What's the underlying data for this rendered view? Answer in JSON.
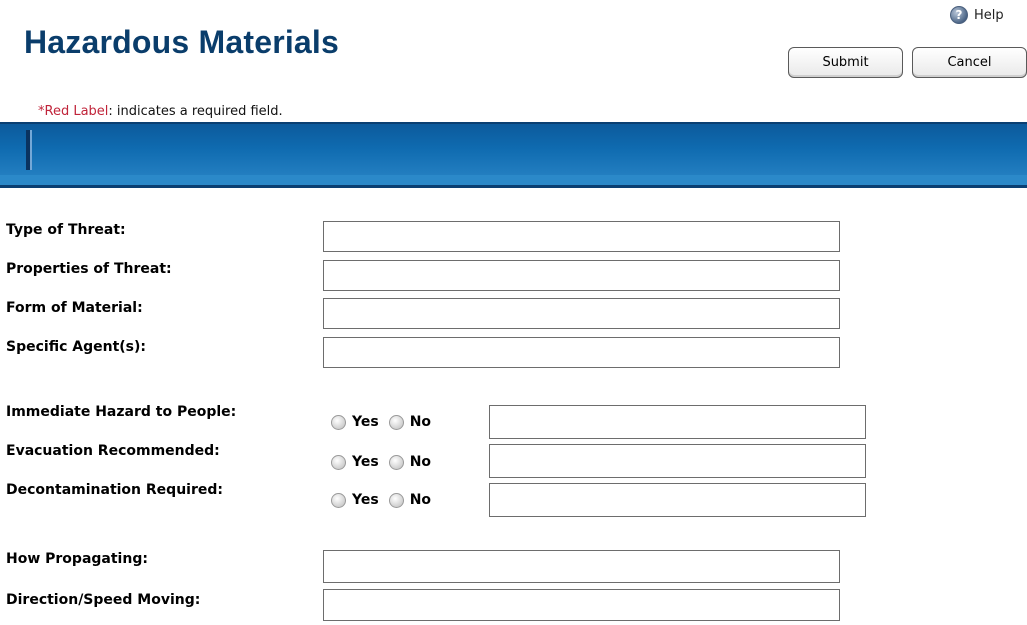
{
  "header": {
    "title": "Hazardous Materials",
    "help_label": "Help",
    "help_icon": "?"
  },
  "toolbar": {
    "submit_label": "Submit",
    "cancel_label": "Cancel"
  },
  "required_note": {
    "red_part": "*Red Label",
    "rest": ": indicates a required field."
  },
  "colors": {
    "title": "#0a3d6b",
    "required_red": "#c0243a",
    "bar_blue": "#0f6bb0"
  },
  "fields": {
    "type_of_threat": {
      "label": "Type of Threat:",
      "value": ""
    },
    "properties_of_threat": {
      "label": "Properties of Threat:",
      "value": ""
    },
    "form_of_material": {
      "label": "Form of Material:",
      "value": ""
    },
    "specific_agents": {
      "label": "Specific Agent(s):",
      "value": ""
    },
    "immediate_hazard": {
      "label": "Immediate Hazard to People:",
      "yes": "Yes",
      "no": "No",
      "value": ""
    },
    "evacuation": {
      "label": "Evacuation Recommended:",
      "yes": "Yes",
      "no": "No",
      "value": ""
    },
    "decontamination": {
      "label": "Decontamination Required:",
      "yes": "Yes",
      "no": "No",
      "value": ""
    },
    "how_propagating": {
      "label": "How Propagating:",
      "value": ""
    },
    "direction_speed": {
      "label": "Direction/Speed Moving:",
      "value": ""
    }
  }
}
